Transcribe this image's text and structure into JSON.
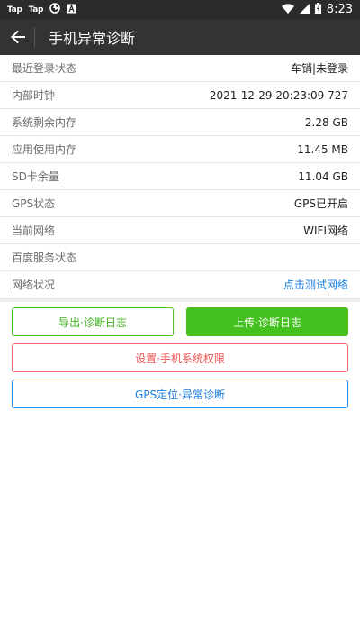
{
  "status_bar": {
    "app1": "Tap",
    "app2": "Tap",
    "time": "8:23",
    "icons": [
      "tap-app-icon",
      "tap-app-icon",
      "aperture-icon",
      "a-notification-icon",
      "wifi-icon",
      "cellular-signal-icon",
      "battery-icon"
    ]
  },
  "toolbar": {
    "title": "手机异常诊断",
    "back_icon": "arrow-left-icon"
  },
  "rows": [
    {
      "label": "最近登录状态",
      "value": "车销|未登录"
    },
    {
      "label": "内部时钟",
      "value": "2021-12-29 20:23:09 727"
    },
    {
      "label": "系统剩余内存",
      "value": "2.28 GB"
    },
    {
      "label": "应用使用内存",
      "value": "11.45 MB"
    },
    {
      "label": "SD卡余量",
      "value": "11.04 GB"
    },
    {
      "label": "GPS状态",
      "value": "GPS已开启"
    },
    {
      "label": "当前网络",
      "value": "WIFI网络"
    },
    {
      "label": "百度服务状态",
      "value": ""
    },
    {
      "label": "网络状况",
      "value": "点击测试网络"
    }
  ],
  "buttons": {
    "export": "导出·诊断日志",
    "upload": "上传·诊断日志",
    "settings": "设置·手机系统权限",
    "gps": "GPS定位·异常诊断"
  },
  "colors": {
    "green": "#44c01f",
    "red": "#ee5252",
    "blue": "#1a7ee0",
    "toolbar": "#333333"
  }
}
